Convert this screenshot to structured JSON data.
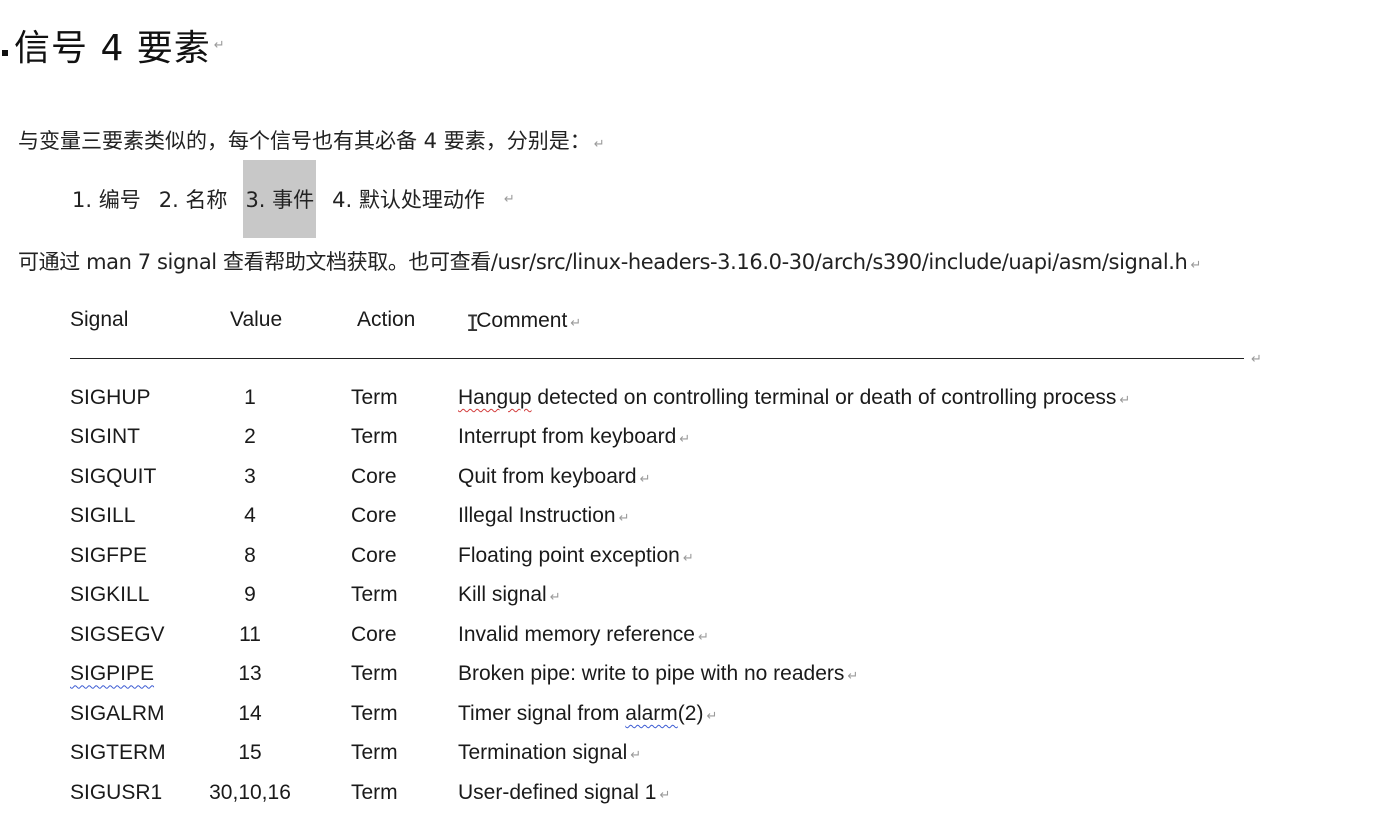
{
  "heading": "信号 4 要素",
  "intro": "与变量三要素类似的，每个信号也有其必备 4 要素，分别是：",
  "elements": [
    {
      "label": "1.  编号"
    },
    {
      "label": "2.  名称"
    },
    {
      "label": "3.  事件"
    },
    {
      "label": "4.  默认处理动作"
    }
  ],
  "reference": "可通过 man 7 signal 查看帮助文档获取。也可查看/usr/src/linux-headers-3.16.0-30/arch/s390/include/uapi/asm/signal.h",
  "table": {
    "headers": {
      "signal": "Signal",
      "value": "Value",
      "action": "Action",
      "comment": "Comment"
    },
    "rows": [
      {
        "signal": "SIGHUP",
        "value": "1",
        "action": "Term",
        "comment": "Hangup detected on controlling terminal or death of controlling process"
      },
      {
        "signal": "SIGINT",
        "value": "2",
        "action": "Term",
        "comment": "Interrupt from keyboard"
      },
      {
        "signal": "SIGQUIT",
        "value": "3",
        "action": "Core",
        "comment": "Quit from keyboard"
      },
      {
        "signal": "SIGILL",
        "value": "4",
        "action": "Core",
        "comment": "Illegal Instruction"
      },
      {
        "signal": "SIGFPE",
        "value": "8",
        "action": "Core",
        "comment": "Floating point exception"
      },
      {
        "signal": "SIGKILL",
        "value": "9",
        "action": "Term",
        "comment": "Kill signal"
      },
      {
        "signal": "SIGSEGV",
        "value": "11",
        "action": "Core",
        "comment": "Invalid memory reference"
      },
      {
        "signal": "SIGPIPE",
        "value": "13",
        "action": "Term",
        "comment": "Broken pipe: write to pipe with no readers"
      },
      {
        "signal": "SIGALRM",
        "value": "14",
        "action": "Term",
        "comment": "Timer signal from alarm(2)"
      },
      {
        "signal": "SIGTERM",
        "value": "15",
        "action": "Term",
        "comment": "Termination signal"
      },
      {
        "signal": "SIGUSR1",
        "value": "30,10,16",
        "action": "Term",
        "comment": "User-defined signal 1"
      }
    ]
  },
  "highlight_color": "#c8c8c8"
}
